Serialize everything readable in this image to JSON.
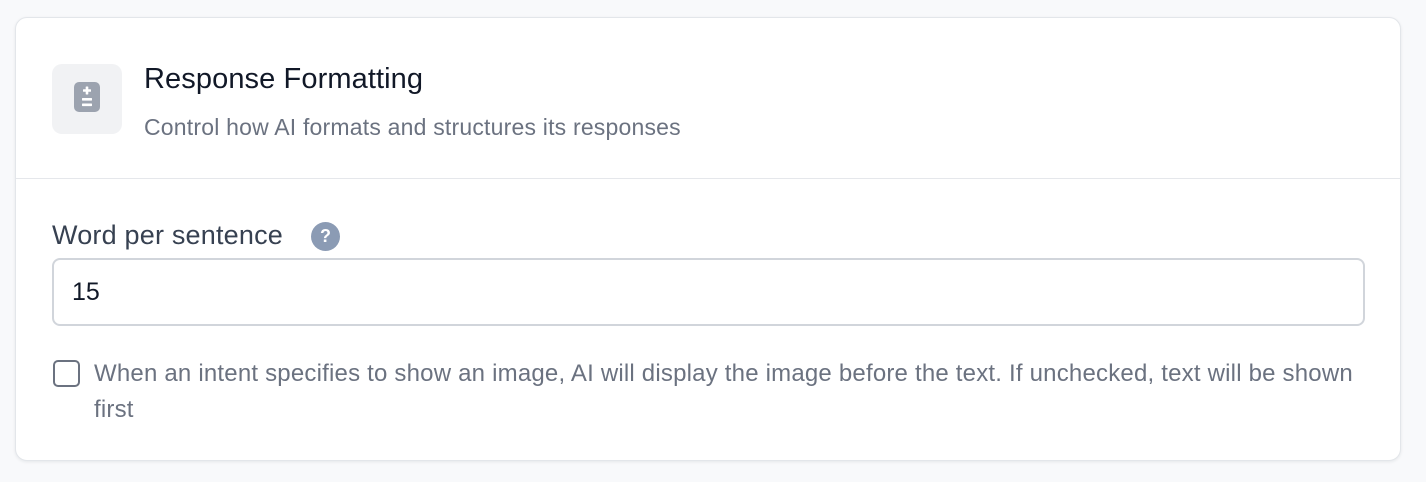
{
  "section": {
    "title": "Response Formatting",
    "subtitle": "Control how AI formats and structures its responses",
    "icon": "calculator-icon"
  },
  "word_per_sentence": {
    "label": "Word per sentence",
    "help_icon": "?",
    "value": "15"
  },
  "image_first": {
    "checked": false,
    "label": "When an intent specifies to show an image, AI will display the image before the text. If unchecked, text will be shown first"
  },
  "colors": {
    "icon_gray": "#9ca3af",
    "help_badge": "#8b9bb4",
    "muted_text": "#6b7280"
  }
}
